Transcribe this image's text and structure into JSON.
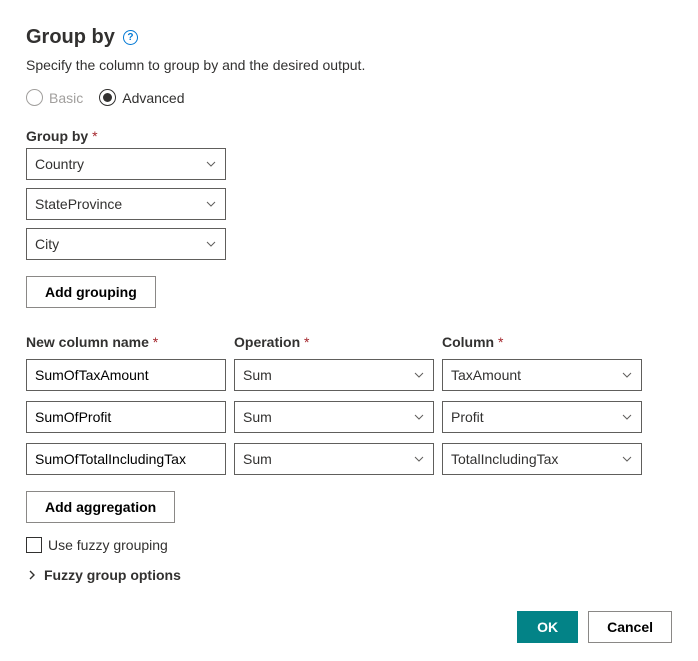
{
  "header": {
    "title": "Group by",
    "subtitle": "Specify the column to group by and the desired output."
  },
  "mode": {
    "basic_label": "Basic",
    "advanced_label": "Advanced"
  },
  "groupby": {
    "label": "Group by",
    "items": [
      "Country",
      "StateProvince",
      "City"
    ],
    "add_button": "Add grouping"
  },
  "aggregations": {
    "labels": {
      "name": "New column name",
      "operation": "Operation",
      "column": "Column"
    },
    "rows": [
      {
        "name": "SumOfTaxAmount",
        "operation": "Sum",
        "column": "TaxAmount"
      },
      {
        "name": "SumOfProfit",
        "operation": "Sum",
        "column": "Profit"
      },
      {
        "name": "SumOfTotalIncludingTax",
        "operation": "Sum",
        "column": "TotalIncludingTax"
      }
    ],
    "add_button": "Add aggregation"
  },
  "fuzzy": {
    "checkbox_label": "Use fuzzy grouping",
    "options_label": "Fuzzy group options"
  },
  "footer": {
    "ok": "OK",
    "cancel": "Cancel"
  }
}
